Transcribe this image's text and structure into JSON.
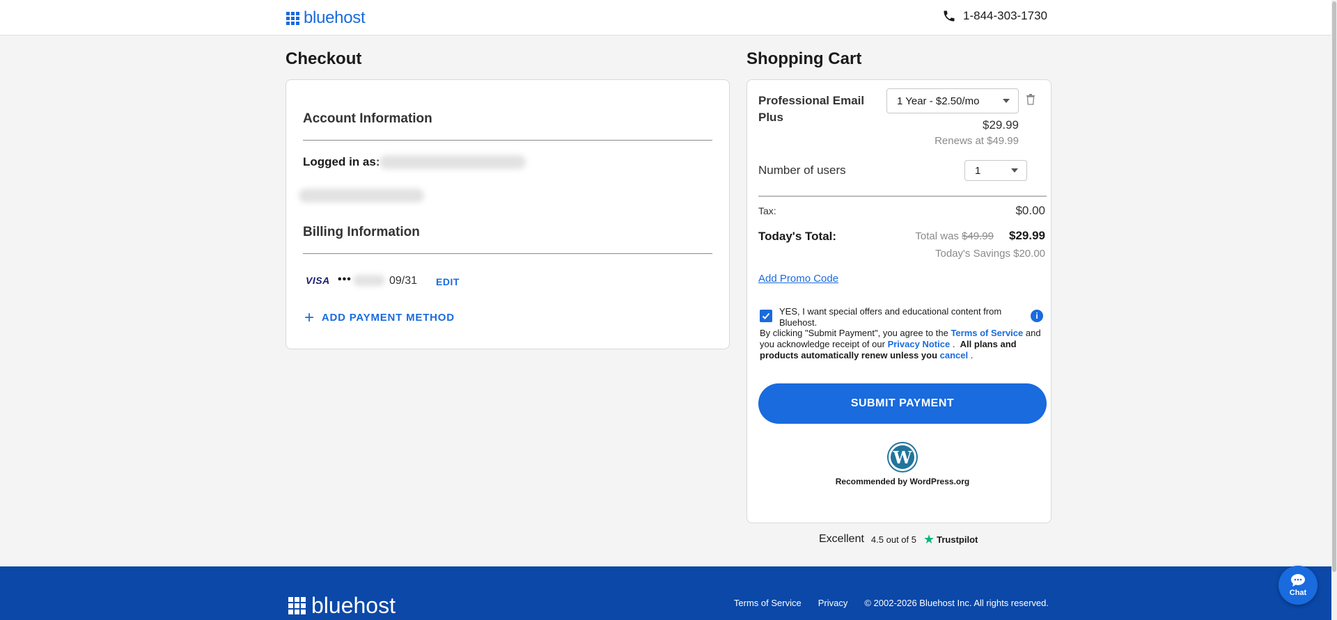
{
  "header": {
    "logo_text": "bluehost",
    "phone": "1-844-303-1730"
  },
  "checkout": {
    "title": "Checkout",
    "account_title": "Account Information",
    "logged_in_label": "Logged in as:",
    "billing_title": "Billing Information",
    "card_brand": "VISA",
    "card_dots": "•••",
    "card_expiry": "09/31",
    "edit_label": "EDIT",
    "add_payment_label": "ADD PAYMENT METHOD"
  },
  "cart": {
    "title": "Shopping Cart",
    "product_name": "Professional Email Plus",
    "term_selected": "1 Year - $2.50/mo",
    "price": "$29.99",
    "renews": "Renews at $49.99",
    "users_label": "Number of users",
    "users_selected": "1",
    "tax_label": "Tax:",
    "tax_value": "$0.00",
    "total_label": "Today's Total:",
    "total_was_prefix": "Total was",
    "total_was_value": "$49.99",
    "total_value": "$29.99",
    "savings": "Today's Savings $20.00",
    "promo_label": "Add Promo Code",
    "offer_text": "YES, I want special offers and educational content from Bluehost.",
    "legal_1": "By clicking \"Submit Payment\", you agree to the",
    "terms_link": "Terms of Service",
    "legal_2": "and you acknowledge receipt of our",
    "privacy_link": "Privacy Notice",
    "legal_3": ".",
    "legal_bold": "All plans and products automatically renew unless you",
    "cancel_link": "cancel",
    "legal_4": ".",
    "submit_label": "SUBMIT PAYMENT",
    "wp_text": "Recommended by WordPress.org"
  },
  "trustpilot": {
    "rating_word": "Excellent",
    "rating_text": "4.5 out of 5",
    "brand": "Trustpilot"
  },
  "footer": {
    "logo_text": "bluehost",
    "terms": "Terms of Service",
    "privacy": "Privacy",
    "copyright": "© 2002-2026 Bluehost Inc. All rights reserved."
  },
  "chat": {
    "label": "Chat"
  },
  "colors": {
    "brand_blue": "#196bde",
    "footer_blue": "#0b48a8",
    "trustpilot_green": "#00b67a"
  },
  "icons": [
    "phone-icon",
    "trash-icon",
    "plus-icon",
    "check-icon",
    "info-icon",
    "wordpress-icon",
    "star-icon",
    "chat-icon"
  ]
}
